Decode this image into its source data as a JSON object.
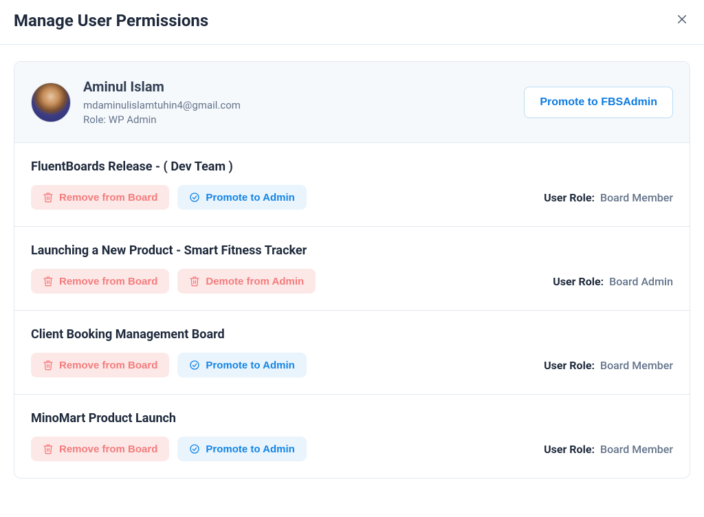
{
  "header": {
    "title": "Manage User Permissions"
  },
  "user": {
    "name": "Aminul Islam",
    "email": "mdaminulislamtuhin4@gmail.com",
    "role_prefix": "Role: ",
    "role": "WP Admin",
    "promote_button": "Promote to FBSAdmin"
  },
  "labels": {
    "remove_from_board": "Remove from Board",
    "promote_to_admin": "Promote to Admin",
    "demote_from_admin": "Demote from Admin",
    "user_role": "User Role:"
  },
  "boards": [
    {
      "title": "FluentBoards Release - ( Dev Team )",
      "secondary_action": "promote",
      "role": "Board Member"
    },
    {
      "title": "Launching a New Product - Smart Fitness Tracker",
      "secondary_action": "demote",
      "role": "Board Admin"
    },
    {
      "title": "Client Booking Management Board",
      "secondary_action": "promote",
      "role": "Board Member"
    },
    {
      "title": "MinoMart Product Launch",
      "secondary_action": "promote",
      "role": "Board Member"
    }
  ]
}
